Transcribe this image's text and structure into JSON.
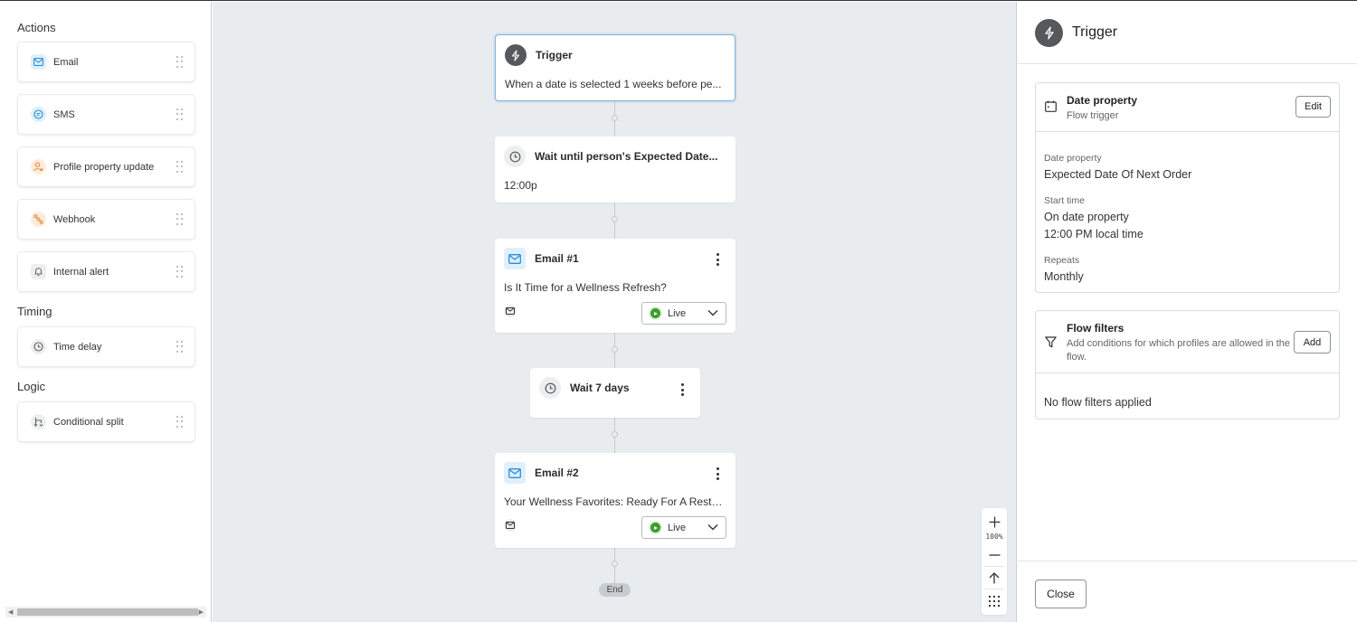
{
  "sidebar": {
    "sections": {
      "actions": "Actions",
      "timing": "Timing",
      "logic": "Logic"
    },
    "actions": [
      {
        "label": "Email",
        "icon": "email-icon"
      },
      {
        "label": "SMS",
        "icon": "sms-icon"
      },
      {
        "label": "Profile property update",
        "icon": "profile-icon"
      },
      {
        "label": "Webhook",
        "icon": "webhook-icon"
      },
      {
        "label": "Internal alert",
        "icon": "bell-icon"
      }
    ],
    "timing": [
      {
        "label": "Time delay",
        "icon": "clock-icon"
      }
    ],
    "logic": [
      {
        "label": "Conditional split",
        "icon": "split-icon"
      }
    ]
  },
  "canvas": {
    "nodes": [
      {
        "type": "trigger",
        "title": "Trigger",
        "subtitle": "When a date is selected 1 weeks before pe..."
      },
      {
        "type": "wait",
        "title": "Wait until person's Expected Date...",
        "subtitle": "12:00p"
      },
      {
        "type": "email",
        "title": "Email #1",
        "subtitle": "Is It Time for a Wellness Refresh?",
        "status": "Live"
      },
      {
        "type": "delay",
        "title": "Wait 7 days"
      },
      {
        "type": "email",
        "title": "Email #2",
        "subtitle": "Your Wellness Favorites: Ready For A Resto...",
        "status": "Live"
      }
    ],
    "end_label": "End",
    "zoom": {
      "level": "100%"
    }
  },
  "panel": {
    "title": "Trigger",
    "trigger_card": {
      "title": "Date property",
      "description": "Flow trigger",
      "edit_label": "Edit",
      "fields": [
        {
          "label": "Date property",
          "values": [
            "Expected Date Of Next Order"
          ]
        },
        {
          "label": "Start time",
          "values": [
            "On date property",
            "12:00 PM local time"
          ]
        },
        {
          "label": "Repeats",
          "values": [
            "Monthly"
          ]
        }
      ]
    },
    "filters_card": {
      "title": "Flow filters",
      "description": "Add conditions for which profiles are allowed in the flow.",
      "add_label": "Add",
      "empty_text": "No flow filters applied"
    },
    "close_label": "Close"
  },
  "colors": {
    "accent_blue": "#2b8fd6",
    "accent_orange": "#e58a3c",
    "live_green": "#3d9b2f",
    "canvas_bg": "#e8ecef",
    "selected_border": "#7fb0dc"
  }
}
